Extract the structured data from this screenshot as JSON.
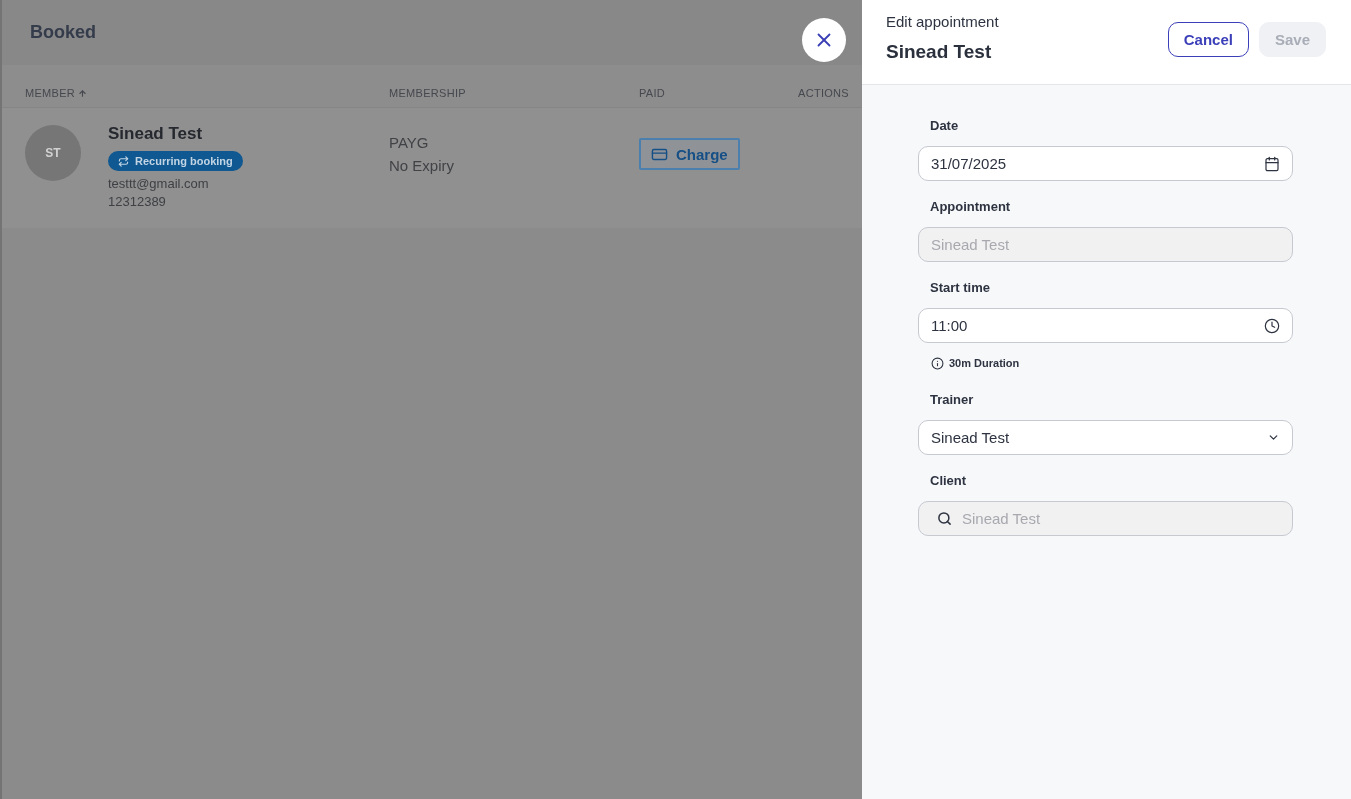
{
  "background_page": {
    "title": "Booked",
    "table": {
      "columns": [
        {
          "label": "MEMBER",
          "sorted": true
        },
        {
          "label": "MEMBERSHIP",
          "sorted": false
        },
        {
          "label": "PAID",
          "sorted": false
        },
        {
          "label": "ACTIONS",
          "sorted": false
        }
      ],
      "rows": [
        {
          "initials": "ST",
          "name": "Sinead Test",
          "badge": "Recurring booking",
          "email": "testtt@gmail.com",
          "phone": "12312389",
          "membership": [
            "PAYG",
            "No Expiry"
          ],
          "action": "Charge"
        }
      ]
    }
  },
  "drawer": {
    "subtitle": "Edit appointment",
    "title": "Sinead Test",
    "buttons": [
      {
        "label": "Cancel",
        "disabled": false
      },
      {
        "label": "Save",
        "disabled": true
      }
    ],
    "fields": [
      {
        "kind": "date",
        "label": "Date",
        "value": "31/07/2025",
        "disabled": false
      },
      {
        "kind": "text",
        "label": "Appointment",
        "value": "Sinead Test",
        "disabled": true
      },
      {
        "kind": "time",
        "label": "Start time",
        "value": "11:00",
        "disabled": false,
        "hint": "30m Duration"
      },
      {
        "kind": "select",
        "label": "Trainer",
        "value": "Sinead Test",
        "disabled": false
      },
      {
        "kind": "search",
        "label": "Client",
        "value": "Sinead Test",
        "disabled": true
      }
    ]
  }
}
